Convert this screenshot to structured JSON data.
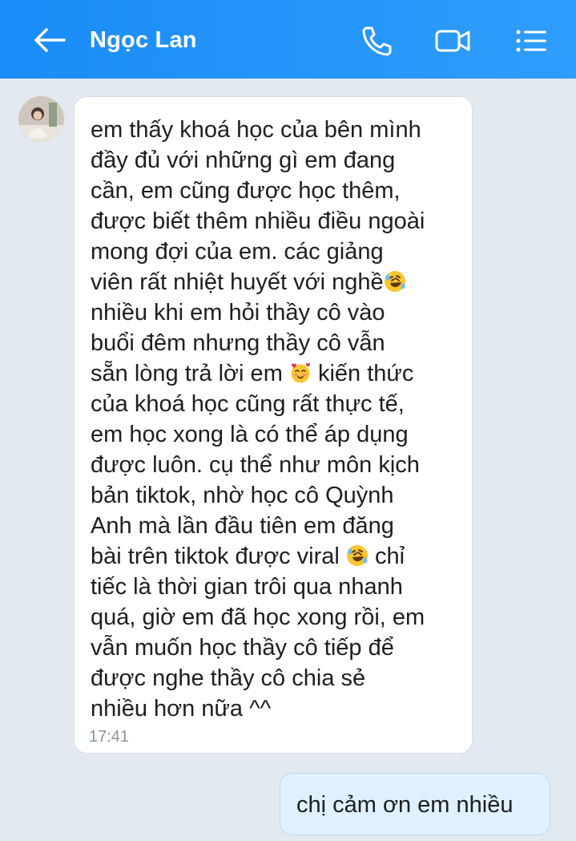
{
  "header": {
    "contact_name": "Ngọc Lan",
    "icons": [
      "back-arrow-icon",
      "phone-icon",
      "video-call-icon",
      "menu-list-icon"
    ]
  },
  "messages": {
    "incoming": {
      "lines": [
        "em thấy khoá học của bên mình",
        "đầy đủ với những gì em đang",
        "cần, em cũng được học thêm,",
        "được biết thêm nhiều điều ngoài",
        "mong đợi của em. các giảng",
        "viên rất nhiệt huyết với nghề",
        "nhiều khi em hỏi thầy cô vào",
        "buổi đêm nhưng thầy cô vẫn",
        "sẵn lòng trả lời em",
        "kiến thức",
        "của khoá học cũng rất thực tế,",
        "em học xong là có thể áp dụng",
        "được luôn. cụ thể như môn kịch",
        "bản tiktok, nhờ học cô Quỳnh",
        "Anh mà lần đầu tiên em đăng",
        "bài trên tiktok được viral",
        "chỉ",
        "tiếc là thời gian trôi qua nhanh",
        "quá, giờ em đã học xong rồi, em",
        "vẫn muốn học thầy cô tiếp để",
        "được nghe thầy cô chia sẻ",
        "nhiều hơn nữa ^^"
      ],
      "time": "17:41"
    },
    "outgoing": {
      "text": "chị cảm ơn em nhiều"
    }
  },
  "colors": {
    "header": "#1a8cf8",
    "background": "#e2e9f1",
    "incoming_bubble": "#ffffff",
    "outgoing_bubble": "#dff1fe"
  }
}
